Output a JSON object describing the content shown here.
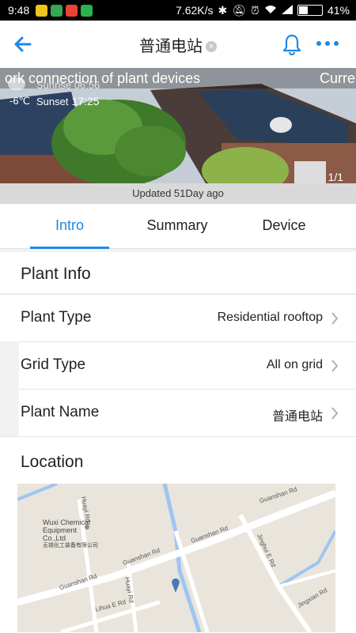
{
  "status_bar": {
    "time": "9:48",
    "net_speed": "7.62K/s",
    "battery": "41%",
    "battery_level": 0.41
  },
  "app_bar": {
    "title": "普通电站",
    "back_icon": "arrow-left-icon",
    "bell_icon": "bell-icon",
    "more_icon": "more-horizontal-icon",
    "accent": "#1e88e5"
  },
  "hero": {
    "marquee_text": "ork connection of plant devices",
    "marquee_tail": "Curre",
    "sunrise": "Sunrise 06:56",
    "temperature": "-6℃",
    "sunset_label": "Sunset",
    "sunset_time": "17:25",
    "page_indicator": "1/1"
  },
  "updated_text": "Updated 51Day ago",
  "tabs": [
    {
      "label": "Intro",
      "active": true
    },
    {
      "label": "Summary",
      "active": false
    },
    {
      "label": "Device",
      "active": false
    }
  ],
  "plant_info": {
    "heading": "Plant Info",
    "rows": [
      {
        "label": "Plant Type",
        "value": "Residential rooftop"
      },
      {
        "label": "Grid Type",
        "value": "All on grid"
      },
      {
        "label": "Plant Name",
        "value": "普通电站"
      }
    ]
  },
  "location": {
    "heading": "Location",
    "map": {
      "labels": [
        "Guanshan Rd",
        "Guanshan Rd",
        "Guanshan Rd",
        "Guanshan Rd",
        "Huayi Rd",
        "Huayi Rd",
        "Jinghui E Rd",
        "Lihua E Rd",
        "Jingxian Rd"
      ],
      "poi_name_en": "Wuxi Chemical Equipment Co.,Ltd",
      "poi_name_zh": "无锡化工装备有限公司",
      "water_color": "#9ec5f2",
      "pin_color": "#4a78b8"
    }
  }
}
